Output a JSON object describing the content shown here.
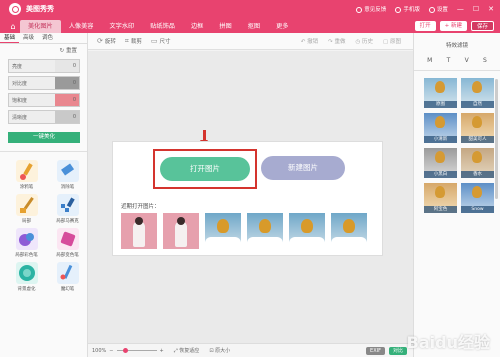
{
  "app": {
    "title": "美图秀秀",
    "accent": "#e8436f",
    "title_actions": [
      "意见反馈",
      "手机版",
      "设置"
    ],
    "window_controls": [
      "—",
      "☐",
      "✕"
    ]
  },
  "menu": {
    "home_icon": "home-icon",
    "tabs": [
      "美化图片",
      "人像美容",
      "文字水印",
      "贴纸饰品",
      "边框",
      "拼图",
      "抠图",
      "更多"
    ],
    "active_tab": "美化图片",
    "right_buttons": {
      "open": "打开",
      "new": "+ 新建",
      "save": "保存"
    }
  },
  "left_panel": {
    "subtabs": [
      "基础",
      "高级",
      "调色"
    ],
    "active_subtab": "基础",
    "reset_label": "重置",
    "sliders": [
      {
        "label": "亮度",
        "value": "0",
        "color": "#e6e6e6"
      },
      {
        "label": "对比度",
        "value": "0",
        "color": "#9a9a9a"
      },
      {
        "label": "饱和度",
        "value": "0",
        "color": "#e9878f"
      },
      {
        "label": "清晰度",
        "value": "0",
        "color": "#c9c9c9"
      }
    ],
    "one_click_label": "一键美化",
    "tools": [
      {
        "label": "涂鸦笔",
        "icon": "brush-icon",
        "color": "#e6a12f"
      },
      {
        "label": "消除笔",
        "icon": "eraser-icon",
        "color": "#4a90d9"
      },
      {
        "label": "局部",
        "icon": "local-brush-icon",
        "color": "#e6a12f"
      },
      {
        "label": "局部马赛克",
        "icon": "mosaic-icon",
        "color": "#3c7fc9"
      },
      {
        "label": "局部彩色笔",
        "icon": "color-pen-icon",
        "color": "#8e5bd6"
      },
      {
        "label": "局部变色笔",
        "icon": "recolor-pen-icon",
        "color": "#d64b9b"
      },
      {
        "label": "背景虚化",
        "icon": "blur-icon",
        "color": "#2bb3a3"
      },
      {
        "label": "魔幻笔",
        "icon": "magic-pen-icon",
        "color": "#4a90d9"
      }
    ]
  },
  "toolbar": {
    "buttons": [
      {
        "label": "旋转",
        "icon": "rotate-icon"
      },
      {
        "label": "裁剪",
        "icon": "crop-icon"
      },
      {
        "label": "尺寸",
        "icon": "resize-icon"
      }
    ],
    "right_buttons": [
      {
        "label": "撤销",
        "icon": "undo-icon"
      },
      {
        "label": "重做",
        "icon": "redo-icon"
      },
      {
        "label": "历史",
        "icon": "history-icon"
      },
      {
        "label": "原图",
        "icon": "original-icon"
      }
    ]
  },
  "canvas": {
    "open_button": "打开图片",
    "new_button": "新建图片",
    "recent_label": "近期打开图片：",
    "recent_thumbs": [
      "person",
      "person",
      "sky",
      "sky",
      "sky",
      "sky",
      "sky"
    ]
  },
  "right_panel": {
    "title": "特效滤镜",
    "tabs": [
      "M",
      "T",
      "V",
      "S"
    ],
    "filters": [
      {
        "label": "原图",
        "style": "plain"
      },
      {
        "label": "自然",
        "style": "plain"
      },
      {
        "label": "小清新",
        "style": "blue"
      },
      {
        "label": "甜美可人",
        "style": "warm"
      },
      {
        "label": "小黑白",
        "style": "gray"
      },
      {
        "label": "香水",
        "style": "sepia"
      },
      {
        "label": "阿宝色",
        "style": "warm"
      },
      {
        "label": "Snow",
        "style": "blue"
      }
    ]
  },
  "statusbar": {
    "zoom": "100%",
    "fit_label": "恢复适应",
    "original_label": "原大小",
    "exif": "EXIF",
    "compare": "对比",
    "zoom_fraction": 0.15
  },
  "watermark": "Baidu经验"
}
